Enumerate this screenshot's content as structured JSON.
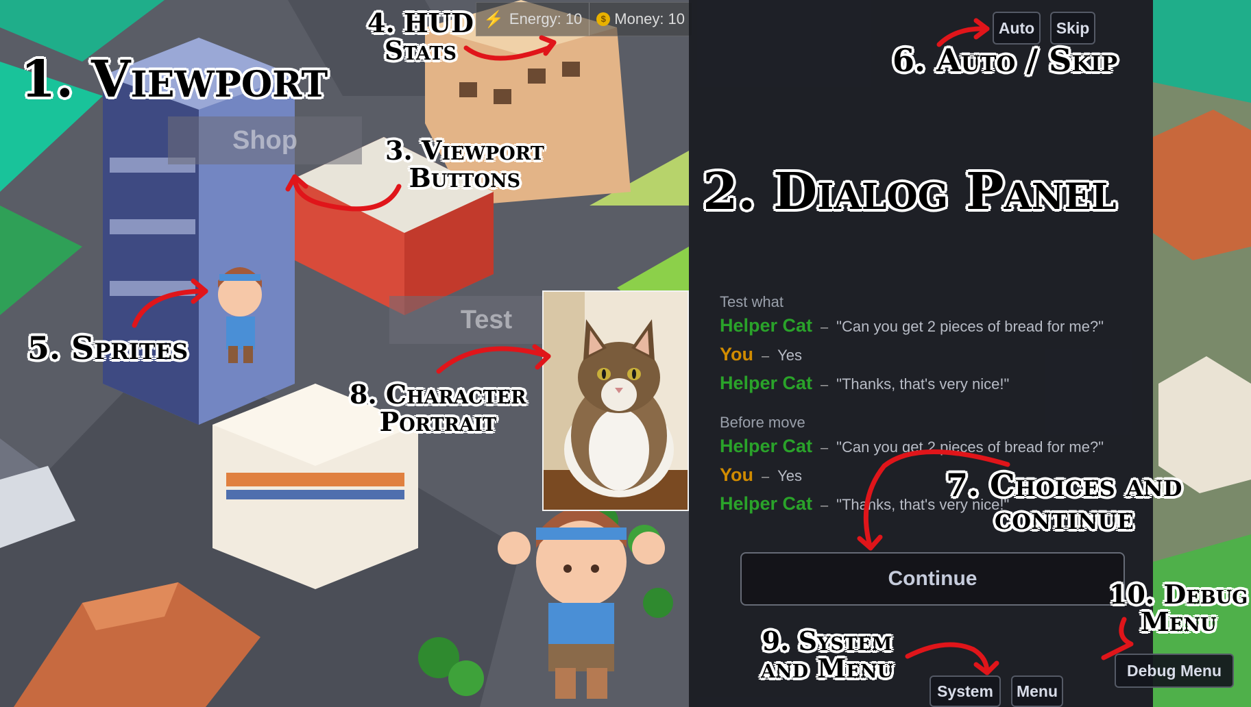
{
  "annotations": {
    "viewport": "1. Viewport",
    "dialog_panel": "2. Dialog Panel",
    "viewport_buttons_1": "3. Viewport",
    "viewport_buttons_2": "Buttons",
    "hud_1": "4. HUD",
    "hud_2": "Stats",
    "sprites": "5. Sprites",
    "auto_skip": "6. Auto / Skip",
    "choices_1": "7. Choices and",
    "choices_2": "continue",
    "portrait_1": "8. Character",
    "portrait_2": "Portrait",
    "system_1": "9. System",
    "system_2": "and Menu",
    "debug_1": "10. Debug",
    "debug_2": "Menu"
  },
  "hud": {
    "energy": "Energy: 10",
    "money": "Money: 10"
  },
  "viewport_buttons": {
    "shop": "Shop",
    "test": "Test"
  },
  "controls": {
    "auto": "Auto",
    "skip": "Skip",
    "system": "System",
    "menu": "Menu",
    "debug": "Debug Menu",
    "continue": "Continue"
  },
  "dialog": {
    "groups": [
      {
        "title": "Test what",
        "lines": [
          {
            "speaker": "Helper Cat",
            "text": "\"Can you get 2 pieces of bread for me?\""
          },
          {
            "speaker": "You",
            "text": "Yes"
          },
          {
            "speaker": "Helper Cat",
            "text": "\"Thanks, that's very nice!\""
          }
        ]
      },
      {
        "title": "Before move",
        "lines": [
          {
            "speaker": "Helper Cat",
            "text": "\"Can you get 2 pieces of bread for me?\""
          },
          {
            "speaker": "You",
            "text": "Yes"
          },
          {
            "speaker": "Helper Cat",
            "text": "\"Thanks, that's very nice!\""
          }
        ]
      }
    ]
  },
  "colors": {
    "speaker_cat": "#2aa32a",
    "speaker_you": "#d08b00",
    "arrow": "#e0151a"
  }
}
